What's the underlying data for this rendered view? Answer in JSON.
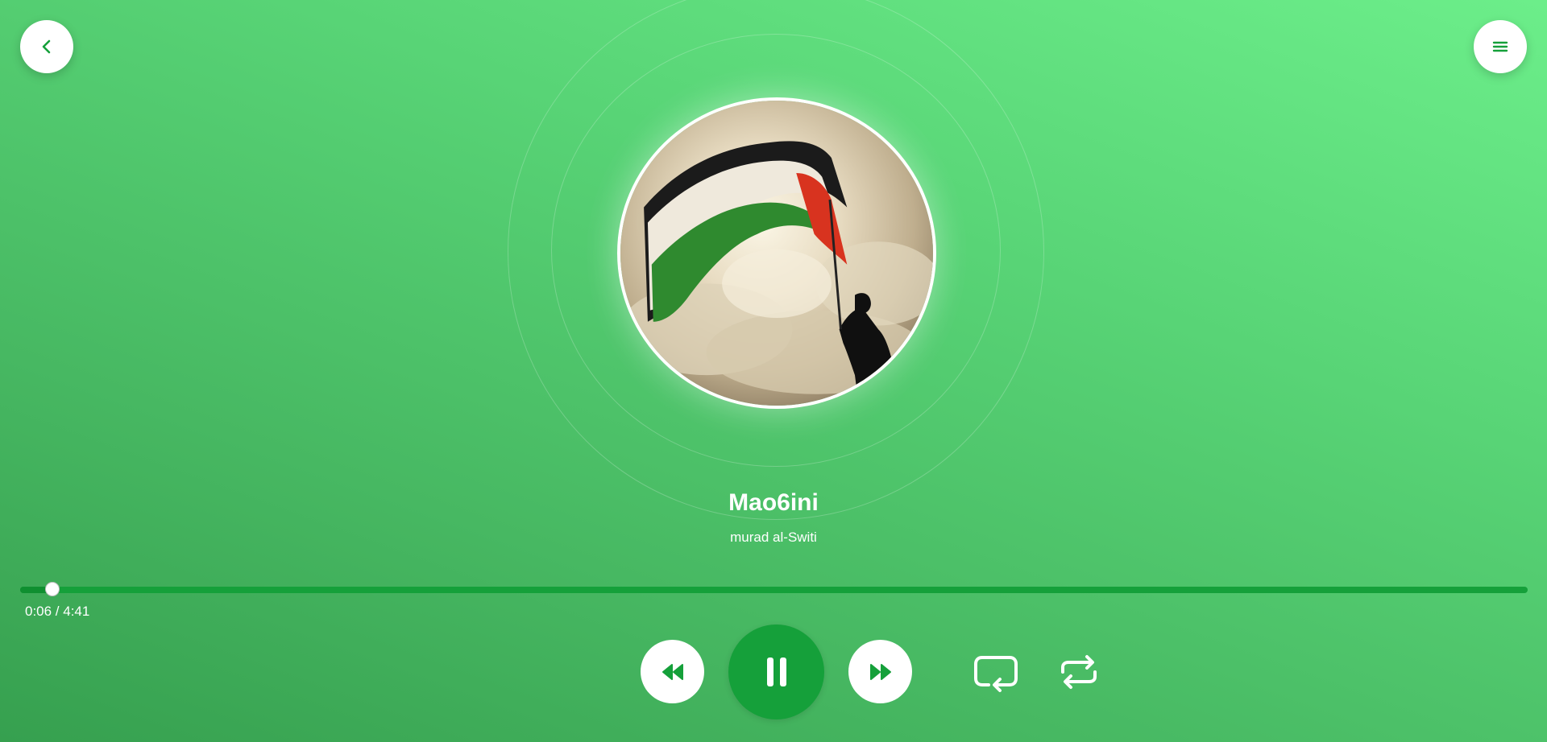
{
  "header": {
    "back_icon": "chevron-left-icon",
    "menu_icon": "hamburger-menu-icon"
  },
  "track": {
    "title": "Mao6ini",
    "artist": "murad al-Switi",
    "artwork": "flag-waving-silhouette-clouds"
  },
  "playback": {
    "time_label": "0:06 / 4:41",
    "elapsed_seconds": 6,
    "duration_seconds": 281
  },
  "controls": {
    "rewind_icon": "rewind-icon",
    "pause_icon": "pause-icon",
    "forward_icon": "fast-forward-icon",
    "repeat_one_icon": "repeat-one-icon",
    "repeat_icon": "repeat-icon"
  },
  "colors": {
    "accent": "#15a03a",
    "background_top": "#6cee8a",
    "background_bottom": "#36a04f"
  }
}
